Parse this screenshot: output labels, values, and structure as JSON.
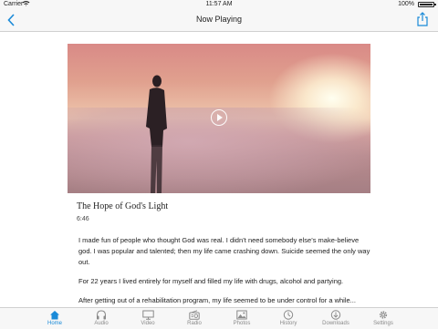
{
  "status_bar": {
    "carrier": "Carrier",
    "time": "11:57 AM",
    "battery": "100%"
  },
  "nav": {
    "title": "Now Playing"
  },
  "story": {
    "title": "The Hope of God's Light",
    "duration": "6:46",
    "paragraphs": [
      "I made fun of people who thought God was real. I didn’t need somebody else’s make-believe god.  I was popular and talented; then my life came crashing down. Suicide seemed the only way out.",
      "For 22 years I lived entirely for myself and filled my life with drugs, alcohol and partying.",
      "After getting out of a rehabilitation program, my life seemed to be under control for a while..."
    ]
  },
  "tabs": [
    {
      "label": "Home",
      "icon": "home-icon",
      "active": true
    },
    {
      "label": "Audio",
      "icon": "headphones-icon",
      "active": false
    },
    {
      "label": "Video",
      "icon": "monitor-icon",
      "active": false
    },
    {
      "label": "Radio",
      "icon": "radio-icon",
      "active": false
    },
    {
      "label": "Photos",
      "icon": "photo-icon",
      "active": false
    },
    {
      "label": "History",
      "icon": "clock-icon",
      "active": false
    },
    {
      "label": "Downloads",
      "icon": "download-icon",
      "active": false
    },
    {
      "label": "Settings",
      "icon": "gear-icon",
      "active": false
    }
  ],
  "colors": {
    "accent": "#1a8ad8",
    "inactive": "#8a8a8a"
  }
}
